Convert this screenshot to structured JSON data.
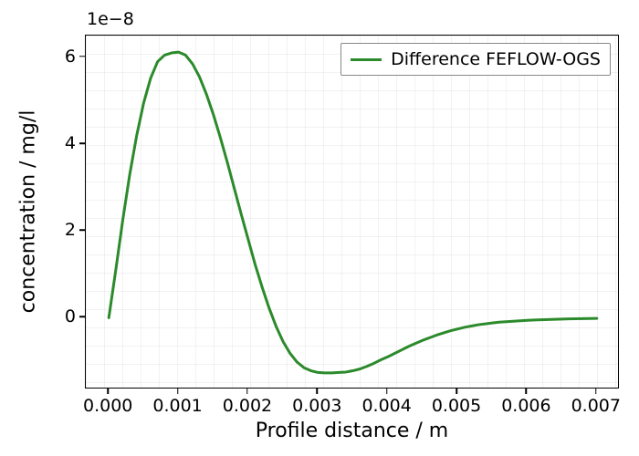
{
  "chart_data": {
    "type": "line",
    "title": "",
    "xlabel": "Profile distance / m",
    "ylabel": "concentration / mg/l",
    "x_ticks": [
      0.0,
      0.001,
      0.002,
      0.003,
      0.004,
      0.005,
      0.006,
      0.007
    ],
    "x_tick_labels": [
      "0.000",
      "0.001",
      "0.002",
      "0.003",
      "0.004",
      "0.005",
      "0.006",
      "0.007"
    ],
    "y_ticks": [
      0,
      2,
      4,
      6
    ],
    "y_tick_labels": [
      "0",
      "2",
      "4",
      "6"
    ],
    "y_offset_text": "1e−8",
    "xlim": [
      -0.00033,
      0.00733
    ],
    "ylim": [
      -1.65,
      6.5
    ],
    "grid": true,
    "legend": {
      "position": "upper right",
      "entries": [
        "Difference FEFLOW-OGS"
      ]
    },
    "series": [
      {
        "name": "Difference FEFLOW-OGS",
        "color": "#2b8a2b",
        "x": [
          0.0,
          0.0001,
          0.0002,
          0.0003,
          0.0004,
          0.0005,
          0.0006,
          0.0007,
          0.0008,
          0.0009,
          0.001,
          0.0011,
          0.0012,
          0.0013,
          0.0014,
          0.0015,
          0.0016,
          0.0017,
          0.0018,
          0.0019,
          0.002,
          0.0021,
          0.0022,
          0.0023,
          0.0024,
          0.0025,
          0.0026,
          0.0027,
          0.0028,
          0.0029,
          0.003,
          0.0031,
          0.0032,
          0.0033,
          0.0034,
          0.0035,
          0.0036,
          0.0037,
          0.0038,
          0.0039,
          0.004,
          0.0041,
          0.0042,
          0.0043,
          0.0044,
          0.0045,
          0.0046,
          0.0047,
          0.0048,
          0.0049,
          0.005,
          0.0051,
          0.0052,
          0.0053,
          0.0054,
          0.0055,
          0.0056,
          0.0057,
          0.0058,
          0.0059,
          0.006,
          0.0061,
          0.0062,
          0.0063,
          0.0064,
          0.0065,
          0.0066,
          0.0067,
          0.0068,
          0.0069,
          0.007
        ],
        "y_scaled_by_1e8": [
          0.0,
          1.1,
          2.25,
          3.3,
          4.2,
          4.95,
          5.52,
          5.9,
          6.05,
          6.1,
          6.12,
          6.05,
          5.85,
          5.55,
          5.15,
          4.68,
          4.15,
          3.58,
          2.98,
          2.38,
          1.8,
          1.22,
          0.7,
          0.22,
          -0.2,
          -0.55,
          -0.82,
          -1.02,
          -1.15,
          -1.22,
          -1.26,
          -1.27,
          -1.27,
          -1.26,
          -1.25,
          -1.22,
          -1.18,
          -1.12,
          -1.05,
          -0.97,
          -0.9,
          -0.82,
          -0.74,
          -0.66,
          -0.59,
          -0.52,
          -0.46,
          -0.4,
          -0.35,
          -0.3,
          -0.26,
          -0.22,
          -0.19,
          -0.16,
          -0.14,
          -0.12,
          -0.1,
          -0.09,
          -0.08,
          -0.07,
          -0.06,
          -0.05,
          -0.045,
          -0.04,
          -0.035,
          -0.03,
          -0.025,
          -0.022,
          -0.02,
          -0.018,
          -0.015
        ]
      }
    ]
  },
  "layout": {
    "axes_left": 93,
    "axes_top": 38,
    "axes_width": 585,
    "axes_height": 388
  }
}
